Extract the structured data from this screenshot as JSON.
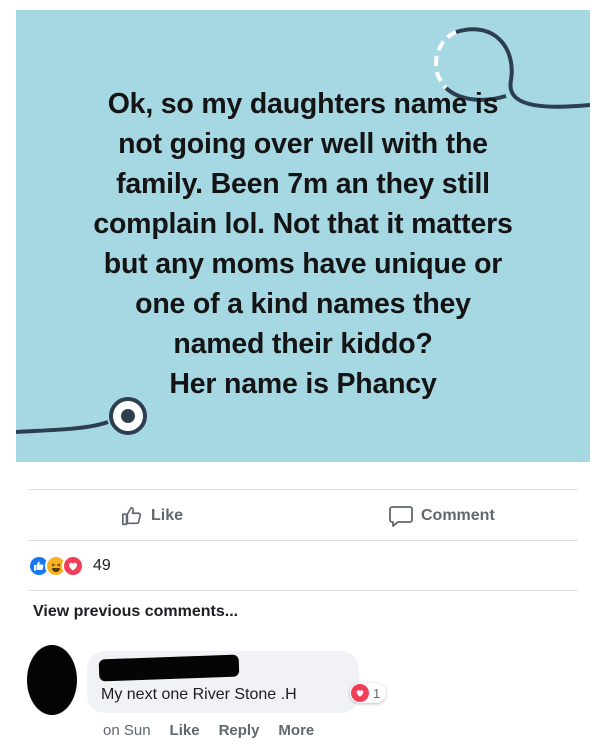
{
  "post": {
    "text": "Ok, so my daughters name is\nnot going over well with the\nfamily. Been 7m an they still\ncomplain lol. Not that it matters\nbut any moms have unique or\none of a kind names they\nnamed their kiddo?\nHer name is Phancy",
    "background_color": "#a6d8e4"
  },
  "actions": {
    "like_label": "Like",
    "comment_label": "Comment"
  },
  "reactions": {
    "icons": [
      "like-icon",
      "haha-icon",
      "love-icon"
    ],
    "count": "49"
  },
  "comments": {
    "view_previous": "View previous comments...",
    "items": [
      {
        "text": "My next one River Stone .H",
        "reaction_count": "1",
        "reaction_icon": "love-icon",
        "time": "on Sun",
        "like": "Like",
        "reply": "Reply",
        "more": "More"
      }
    ]
  }
}
